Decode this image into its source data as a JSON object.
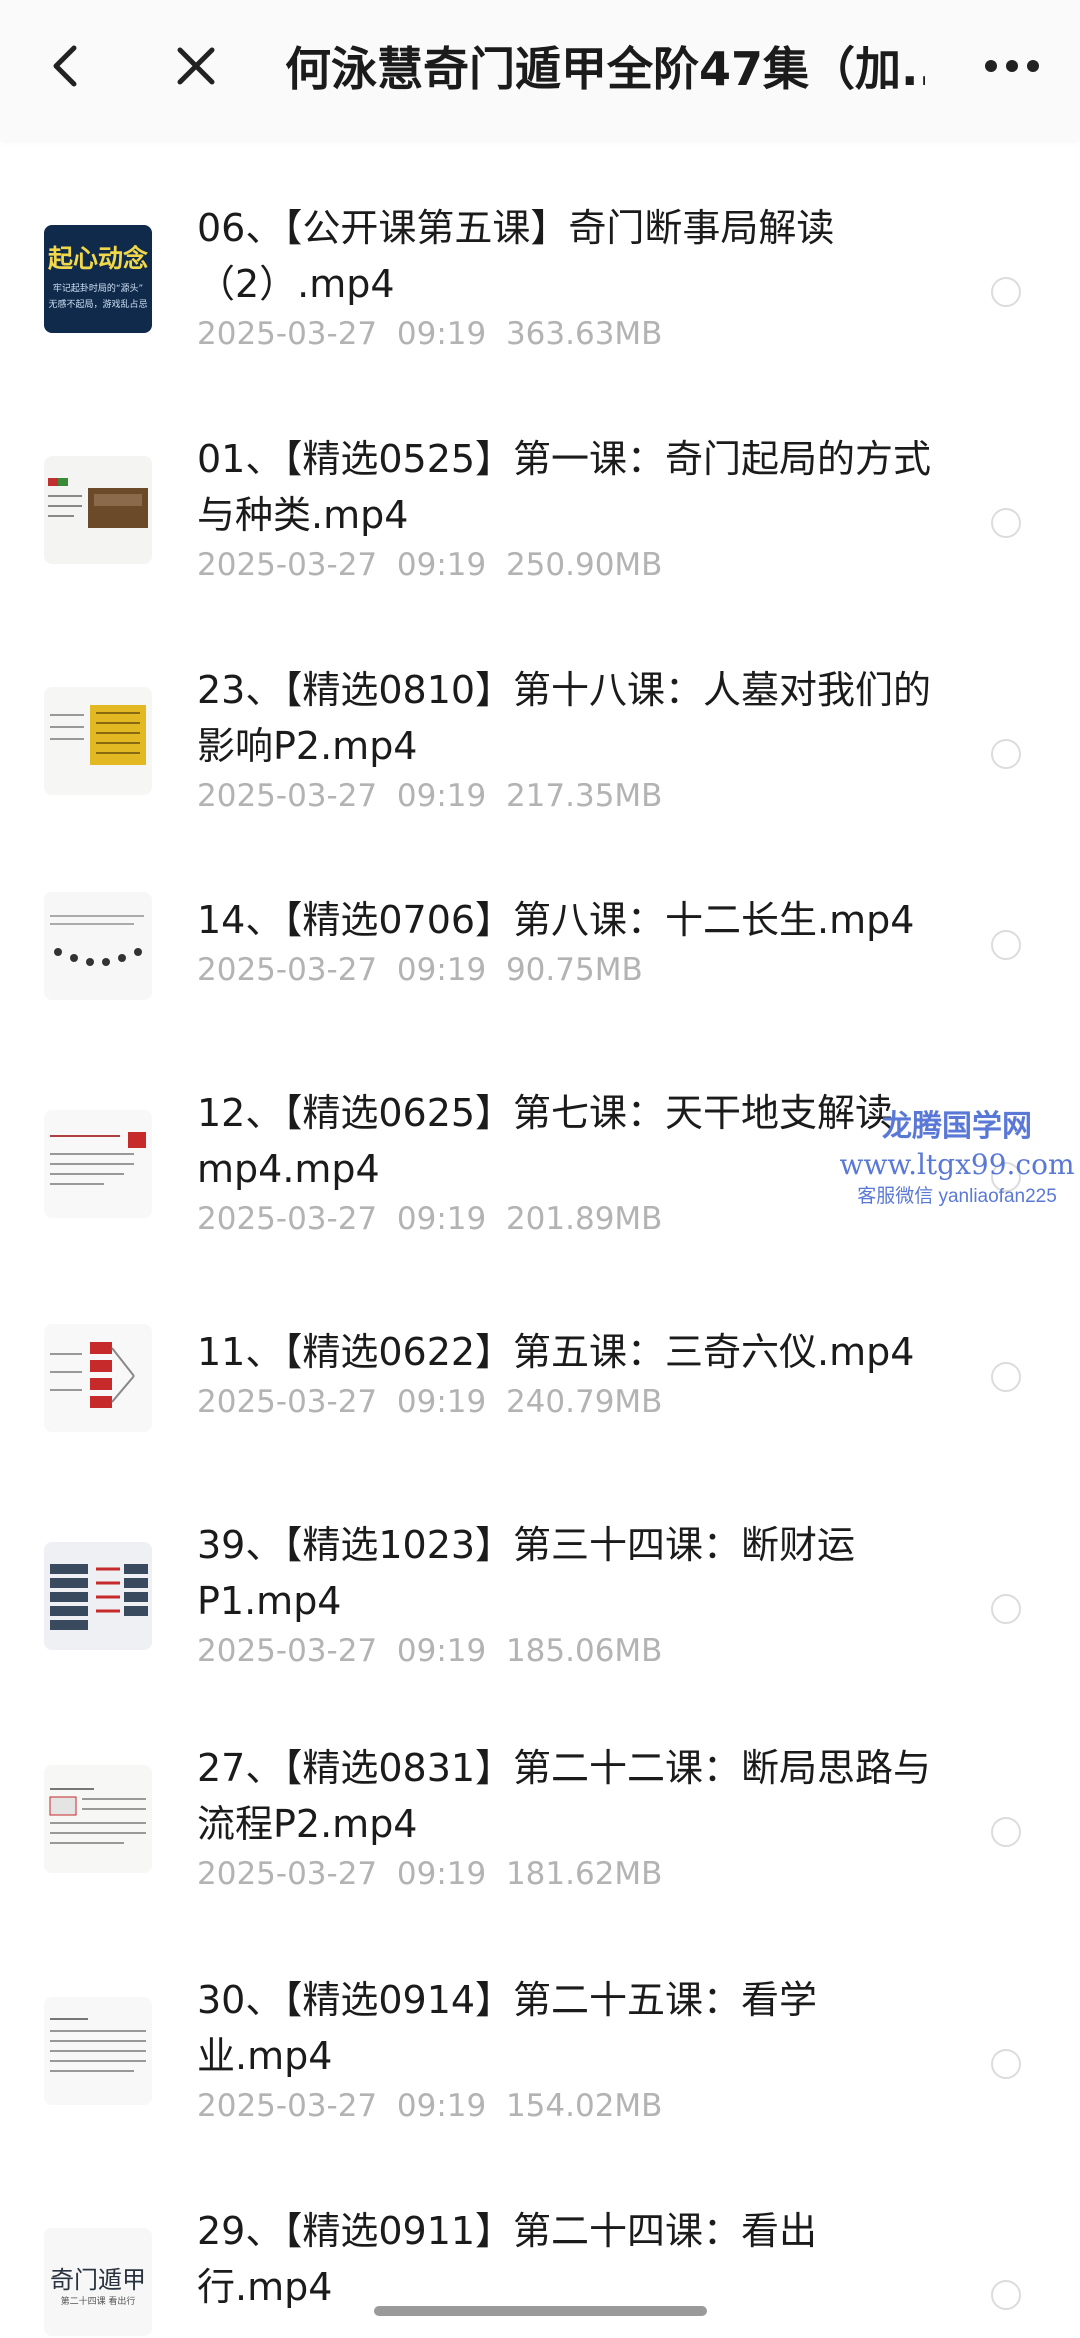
{
  "header": {
    "title": "何泳慧奇门遁甲全阶47集（加..."
  },
  "watermark": {
    "line1": "龙腾国学网",
    "line2": "www.ltgx99.com",
    "line3": "客服微信 yanliaofan225"
  },
  "files": [
    {
      "title": "06、【公开课第五课】奇门断事局解读（2）.mp4",
      "date": "2025-03-27",
      "time": "09:19",
      "size": "363.63MB"
    },
    {
      "title": "01、【精选0525】第一课：奇门起局的方式与种类.mp4",
      "date": "2025-03-27",
      "time": "09:19",
      "size": "250.90MB"
    },
    {
      "title": "23、【精选0810】第十八课：人墓对我们的影响P2.mp4",
      "date": "2025-03-27",
      "time": "09:19",
      "size": "217.35MB"
    },
    {
      "title": "14、【精选0706】第八课：十二长生.mp4",
      "date": "2025-03-27",
      "time": "09:19",
      "size": "90.75MB"
    },
    {
      "title": "12、【精选0625】第七课：天干地支解读mp4.mp4",
      "date": "2025-03-27",
      "time": "09:19",
      "size": "201.89MB"
    },
    {
      "title": "11、【精选0622】第五课：三奇六仪.mp4",
      "date": "2025-03-27",
      "time": "09:19",
      "size": "240.79MB"
    },
    {
      "title": "39、【精选1023】第三十四课：断财运P1.mp4",
      "date": "2025-03-27",
      "time": "09:19",
      "size": "185.06MB"
    },
    {
      "title": "27、【精选0831】第二十二课：断局思路与流程P2.mp4",
      "date": "2025-03-27",
      "time": "09:19",
      "size": "181.62MB"
    },
    {
      "title": "30、【精选0914】第二十五课：看学业.mp4",
      "date": "2025-03-27",
      "time": "09:19",
      "size": "154.02MB"
    },
    {
      "title": "29、【精选0911】第二十四课：看出行.mp4",
      "date": "",
      "time": "",
      "size": ""
    }
  ],
  "thumb_text": {
    "first_main": "起心动念",
    "first_sub1": "牢记起卦时局的“源头”",
    "first_sub2": "无感不起局，游戏乱占忌",
    "last_main": "奇门遁甲",
    "last_sub": "第二十四课 看出行"
  }
}
